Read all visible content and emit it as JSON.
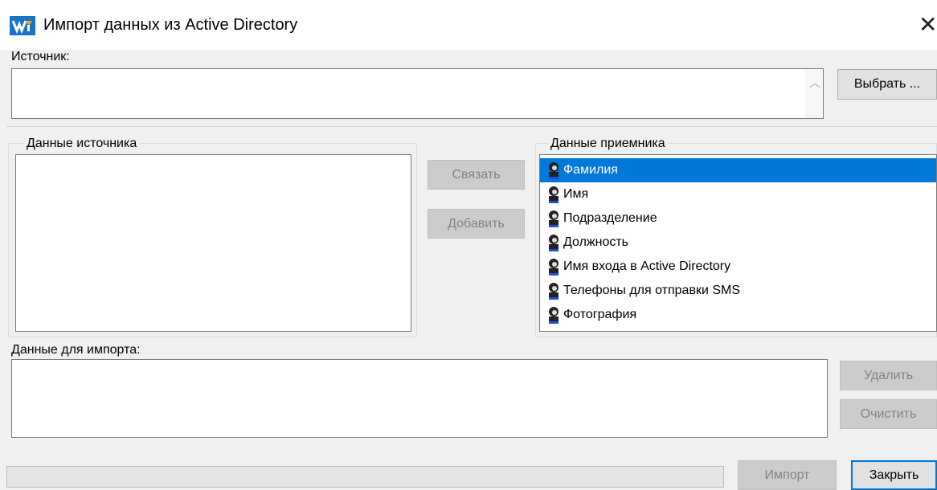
{
  "window": {
    "title": "Импорт данных из Active Directory",
    "close_symbol": "✕",
    "app_icon": "app-logo-icon",
    "accent_color": "#0078d7"
  },
  "source": {
    "label": "Источник:",
    "value": "",
    "choose_button": "Выбрать ..."
  },
  "source_data": {
    "title": "Данные источника",
    "items": []
  },
  "actions": {
    "link_button": "Связать",
    "add_button": "Добавить"
  },
  "target_data": {
    "title": "Данные приемника",
    "item_icon": "person-icon",
    "items": [
      {
        "label": "Фамилия",
        "selected": true
      },
      {
        "label": "Имя",
        "selected": false
      },
      {
        "label": "Подразделение",
        "selected": false
      },
      {
        "label": "Должность",
        "selected": false
      },
      {
        "label": "Имя входа в Active Directory",
        "selected": false
      },
      {
        "label": "Телефоны для отправки SMS",
        "selected": false
      },
      {
        "label": "Фотография",
        "selected": false
      }
    ]
  },
  "import_data": {
    "label": "Данные для импорта:",
    "delete_button": "Удалить",
    "clear_button": "Очистить"
  },
  "footer": {
    "import_button": "Импорт",
    "close_button": "Закрыть"
  }
}
